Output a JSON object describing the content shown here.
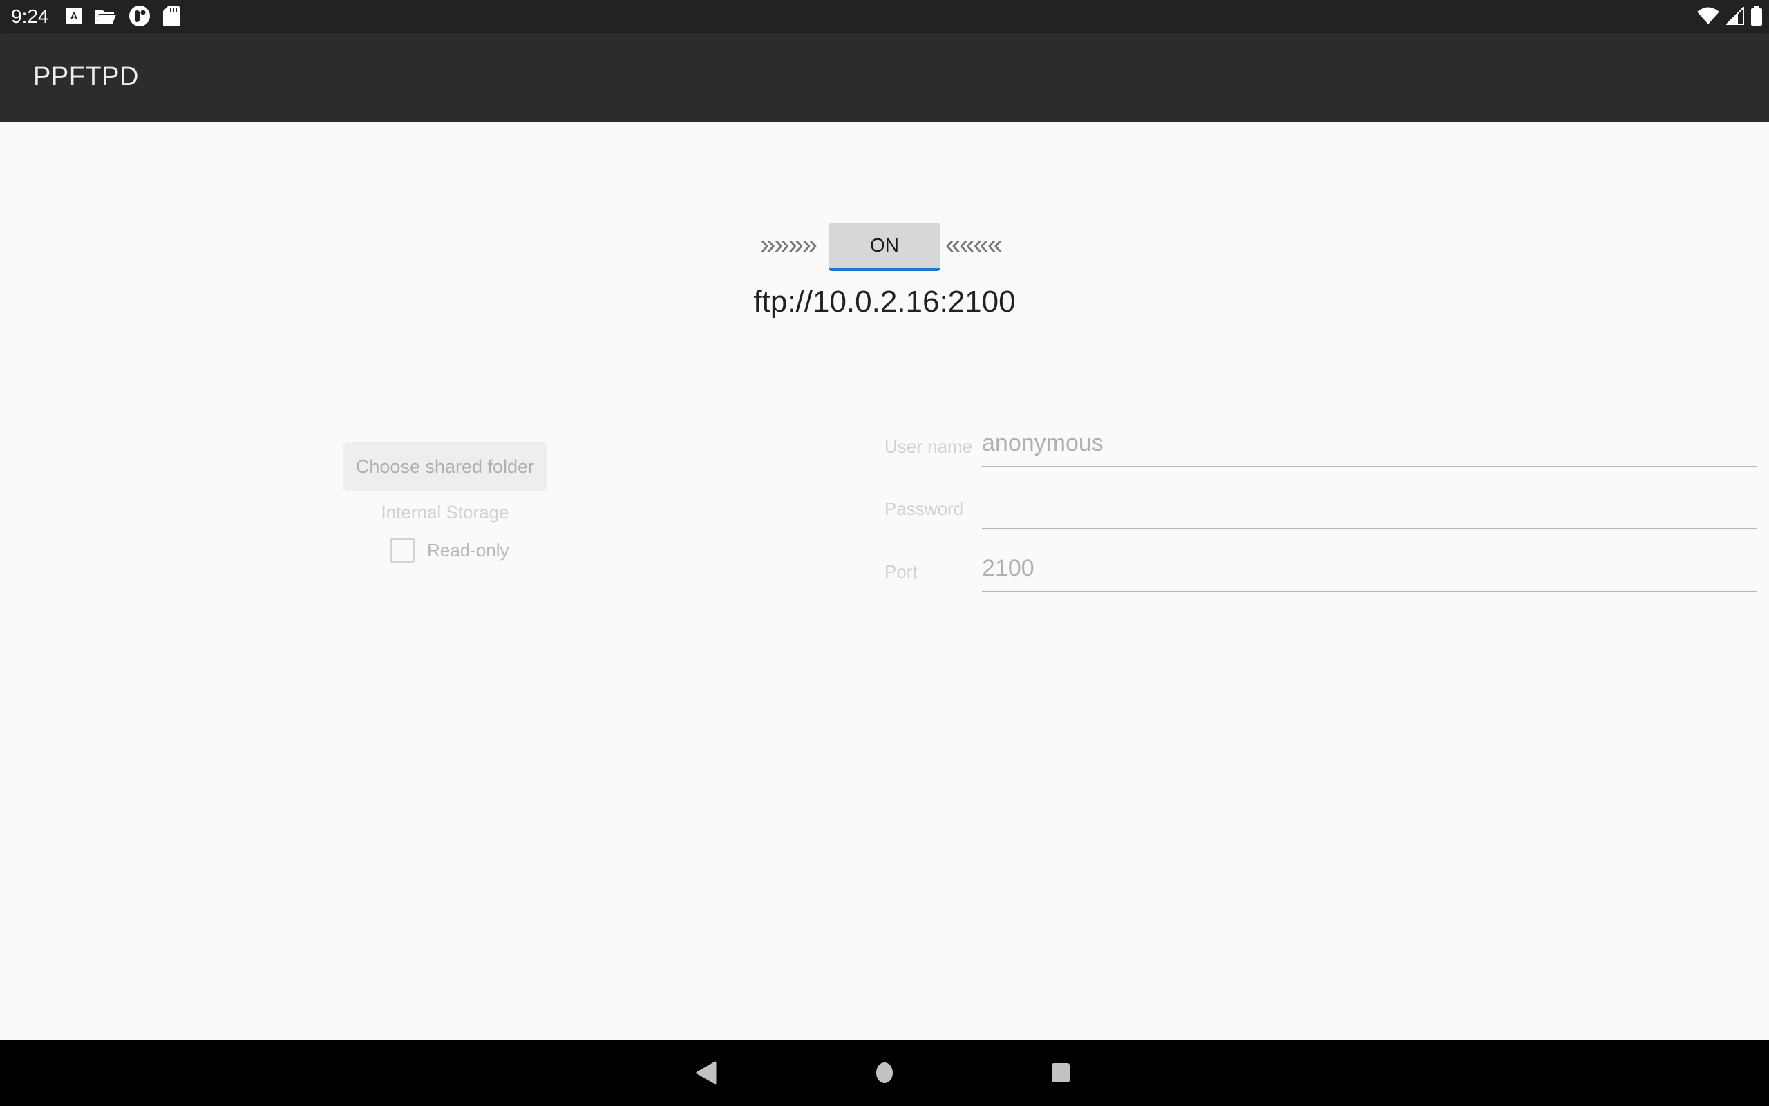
{
  "status_bar": {
    "time": "9:24",
    "left_icons": [
      "font-a-icon",
      "folder-icon",
      "app-circle-icon",
      "sd-card-icon"
    ],
    "right_icons": [
      "wifi-icon",
      "cell-signal-icon",
      "battery-icon"
    ]
  },
  "app_bar": {
    "title": "PPFTPD"
  },
  "server": {
    "arrows_left": "»»»»",
    "toggle_label": "ON",
    "arrows_right": "««««",
    "url": "ftp://10.0.2.16:2100",
    "toggle_accent": "#1e74d4"
  },
  "folder": {
    "choose_button_label": "Choose shared folder",
    "storage_label": "Internal Storage",
    "readonly_label": "Read-only",
    "readonly_checked": false
  },
  "form": {
    "username_label": "User name",
    "username_value": "anonymous",
    "password_label": "Password",
    "password_value": "",
    "port_label": "Port",
    "port_value": "2100"
  },
  "nav_bar": {
    "buttons": [
      "back-icon",
      "home-icon",
      "recents-icon"
    ]
  }
}
